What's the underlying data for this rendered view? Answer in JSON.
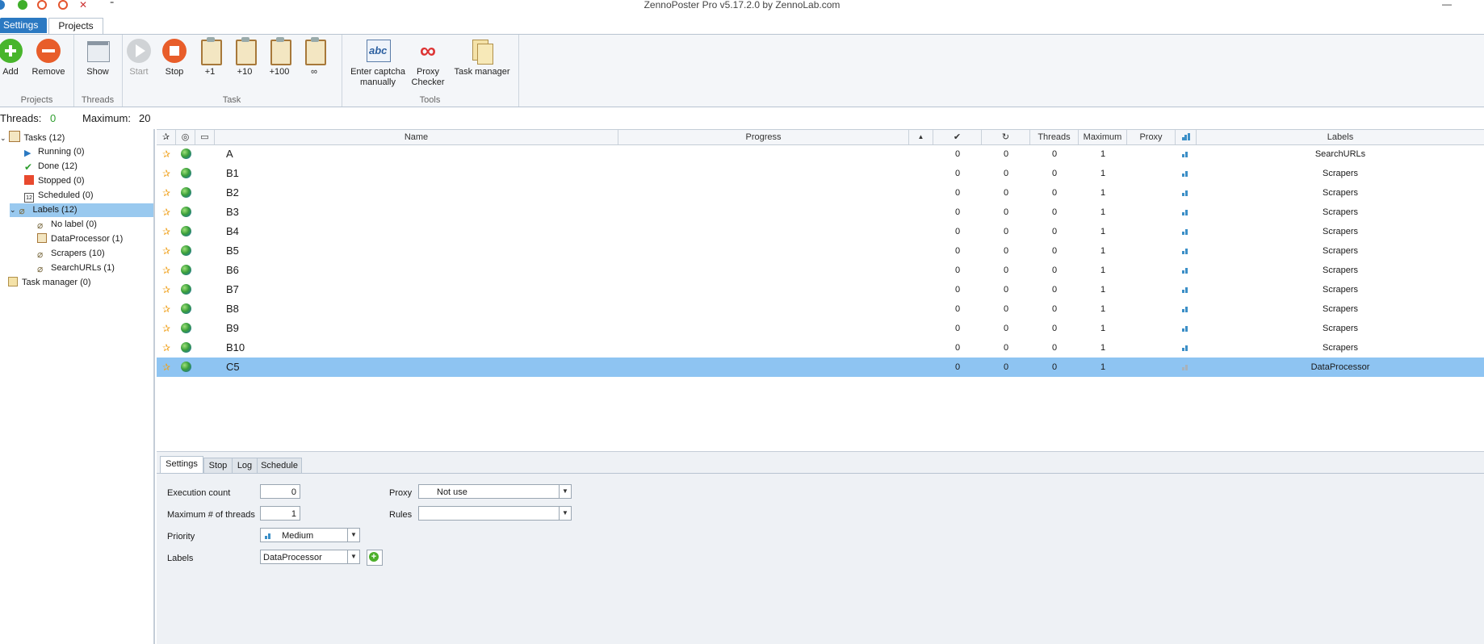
{
  "window": {
    "title": "ZennoPoster Pro v5.17.2.0 by ZennoLab.com",
    "minimize": "—"
  },
  "ribbon_tabs": [
    "Settings",
    "Projects"
  ],
  "ribbon": {
    "groups": {
      "projects": "Projects",
      "threads": "Threads",
      "task": "Task",
      "tools": "Tools"
    },
    "buttons": {
      "add": "Add",
      "remove": "Remove",
      "show": "Show",
      "start": "Start",
      "stop": "Stop",
      "plus1": "+1",
      "plus10": "+10",
      "plus100": "+100",
      "infinite": "∞",
      "captcha": "Enter captcha manually",
      "proxy_checker": "Proxy Checker",
      "task_manager": "Task manager"
    }
  },
  "status": {
    "threads_label": "Threads:",
    "threads_value": "0",
    "maximum_label": "Maximum:",
    "maximum_value": "20"
  },
  "tree": [
    {
      "label": "Tasks (12)"
    },
    {
      "label": "Running (0)"
    },
    {
      "label": "Done (12)"
    },
    {
      "label": "Stopped (0)"
    },
    {
      "label": "Scheduled (0)"
    },
    {
      "label": "Labels (12)"
    },
    {
      "label": "No label (0)"
    },
    {
      "label": "DataProcessor (1)"
    },
    {
      "label": "Scrapers (10)"
    },
    {
      "label": "SearchURLs (1)"
    },
    {
      "label": "Task manager (0)"
    }
  ],
  "grid": {
    "columns": {
      "name": "Name",
      "progress": "Progress",
      "done_icon": "✔",
      "repeat_icon": "↻",
      "threads": "Threads",
      "maximum": "Maximum",
      "proxy": "Proxy",
      "labels": "Labels"
    },
    "rows": [
      {
        "name": "A",
        "done": "0",
        "fail": "0",
        "threads": "0",
        "max": "1",
        "label": "SearchURLs"
      },
      {
        "name": "B1",
        "done": "0",
        "fail": "0",
        "threads": "0",
        "max": "1",
        "label": "Scrapers"
      },
      {
        "name": "B2",
        "done": "0",
        "fail": "0",
        "threads": "0",
        "max": "1",
        "label": "Scrapers"
      },
      {
        "name": "B3",
        "done": "0",
        "fail": "0",
        "threads": "0",
        "max": "1",
        "label": "Scrapers"
      },
      {
        "name": "B4",
        "done": "0",
        "fail": "0",
        "threads": "0",
        "max": "1",
        "label": "Scrapers"
      },
      {
        "name": "B5",
        "done": "0",
        "fail": "0",
        "threads": "0",
        "max": "1",
        "label": "Scrapers"
      },
      {
        "name": "B6",
        "done": "0",
        "fail": "0",
        "threads": "0",
        "max": "1",
        "label": "Scrapers"
      },
      {
        "name": "B7",
        "done": "0",
        "fail": "0",
        "threads": "0",
        "max": "1",
        "label": "Scrapers"
      },
      {
        "name": "B8",
        "done": "0",
        "fail": "0",
        "threads": "0",
        "max": "1",
        "label": "Scrapers"
      },
      {
        "name": "B9",
        "done": "0",
        "fail": "0",
        "threads": "0",
        "max": "1",
        "label": "Scrapers"
      },
      {
        "name": "B10",
        "done": "0",
        "fail": "0",
        "threads": "0",
        "max": "1",
        "label": "Scrapers"
      },
      {
        "name": "C5",
        "done": "0",
        "fail": "0",
        "threads": "0",
        "max": "1",
        "label": "DataProcessor"
      }
    ]
  },
  "bottom_tabs": [
    "Settings",
    "Stop",
    "Log",
    "Schedule"
  ],
  "settings_form": {
    "execution_count_label": "Execution count",
    "execution_count_value": "0",
    "max_threads_label": "Maximum # of threads",
    "max_threads_value": "1",
    "priority_label": "Priority",
    "priority_value": "Medium",
    "labels_label": "Labels",
    "labels_value": "DataProcessor",
    "proxy_label": "Proxy",
    "proxy_value": "Not use",
    "rules_label": "Rules",
    "rules_value": ""
  },
  "colors": {
    "accent": "#2b79c2",
    "selection": "#8ec4f2",
    "tree_selection": "#99c9ef",
    "threads_value": "#2e9e2e"
  }
}
